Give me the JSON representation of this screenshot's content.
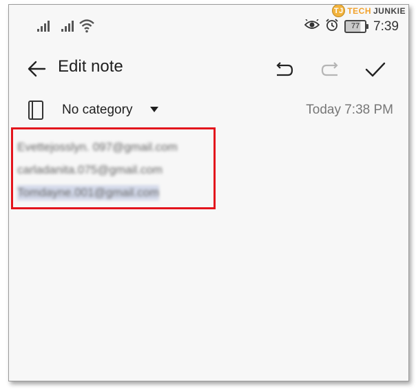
{
  "status_bar": {
    "time": "7:39",
    "battery": "77",
    "icons": [
      "signal-icon",
      "signal-icon",
      "wifi-icon",
      "eye-icon",
      "alarm-icon",
      "battery-icon"
    ]
  },
  "watermark": {
    "logo": "TJ",
    "tech": "TECH",
    "junkie": "JUNKIE"
  },
  "header": {
    "title": "Edit note",
    "icons": [
      "back-arrow-icon",
      "undo-icon",
      "redo-icon",
      "check-icon"
    ]
  },
  "category": {
    "label": "No category",
    "date": "Today 7:38 PM"
  },
  "note": {
    "lines": [
      "Evettejosslyn. 097@gmail.com",
      "carladanita.075@gmail.com",
      "Tomdayne.001@gmail.com"
    ]
  },
  "colors": {
    "highlight_border": "#e3141c",
    "background": "#f7f7f7"
  }
}
